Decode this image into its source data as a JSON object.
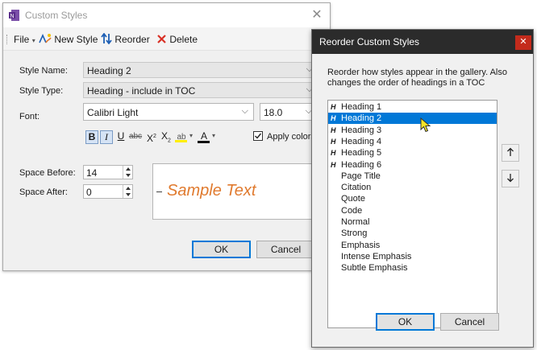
{
  "main_dialog": {
    "title": "Custom Styles",
    "toolbar": {
      "file_label": "File",
      "new_style_label": "New Style",
      "reorder_label": "Reorder",
      "delete_label": "Delete"
    },
    "style_name_label": "Style Name:",
    "style_name_value": "Heading 2",
    "style_type_label": "Style Type:",
    "style_type_value": "Heading - include in TOC",
    "font_label": "Font:",
    "font_value": "Calibri Light",
    "font_size_value": "18.0",
    "apply_colors_label": "Apply colors",
    "apply_colors_checked": true,
    "space_before_label": "Space Before:",
    "space_before_value": "14",
    "space_after_label": "Space After:",
    "space_after_value": "0",
    "sample_text": "Sample Text",
    "ok_label": "OK",
    "cancel_label": "Cancel",
    "colors": {
      "sample_text": "#e07a2e",
      "delete": "#d93025",
      "highlight": "#ffee00"
    }
  },
  "reorder_dialog": {
    "title": "Reorder Custom Styles",
    "description": "Reorder how styles appear in the gallery. Also changes the order of headings in a TOC",
    "items": [
      {
        "label": "Heading 1",
        "heading": true,
        "selected": false
      },
      {
        "label": "Heading 2",
        "heading": true,
        "selected": true
      },
      {
        "label": "Heading 3",
        "heading": true,
        "selected": false
      },
      {
        "label": "Heading 4",
        "heading": true,
        "selected": false
      },
      {
        "label": "Heading 5",
        "heading": true,
        "selected": false
      },
      {
        "label": "Heading 6",
        "heading": true,
        "selected": false
      },
      {
        "label": "Page Title",
        "heading": false,
        "selected": false
      },
      {
        "label": "Citation",
        "heading": false,
        "selected": false
      },
      {
        "label": "Quote",
        "heading": false,
        "selected": false
      },
      {
        "label": "Code",
        "heading": false,
        "selected": false
      },
      {
        "label": "Normal",
        "heading": false,
        "selected": false
      },
      {
        "label": "Strong",
        "heading": false,
        "selected": false
      },
      {
        "label": "Emphasis",
        "heading": false,
        "selected": false
      },
      {
        "label": "Intense Emphasis",
        "heading": false,
        "selected": false
      },
      {
        "label": "Subtle Emphasis",
        "heading": false,
        "selected": false
      }
    ],
    "heading_glyph": "H",
    "ok_label": "OK",
    "cancel_label": "Cancel",
    "colors": {
      "selection": "#0078d7",
      "titlebar": "#2b2b2b",
      "close": "#c42b1c"
    }
  }
}
